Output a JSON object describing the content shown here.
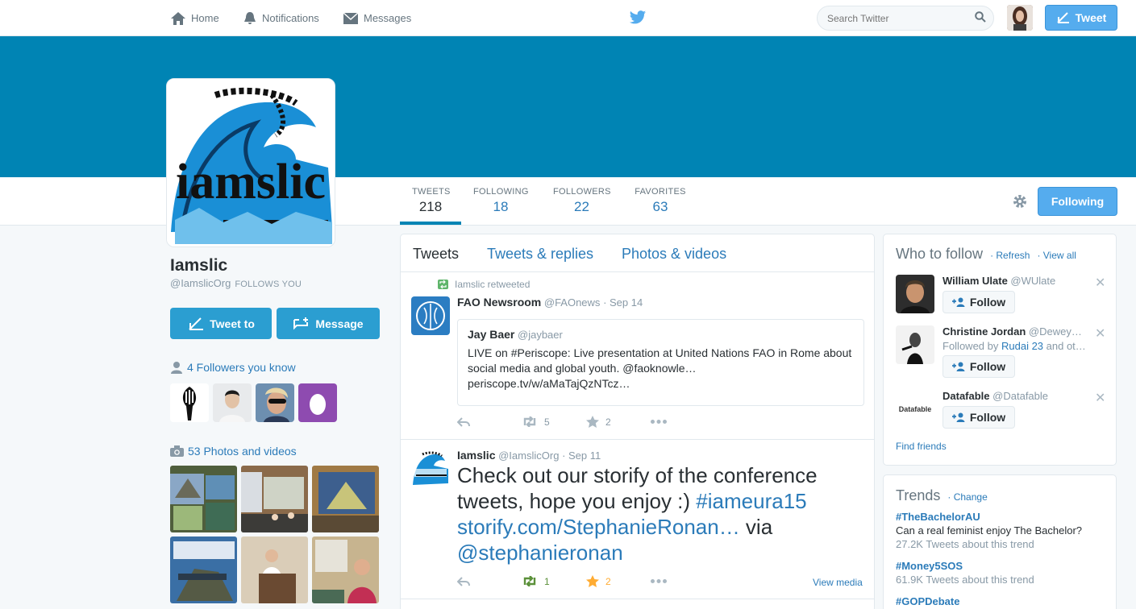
{
  "nav": {
    "home": "Home",
    "notifications": "Notifications",
    "messages": "Messages",
    "search_placeholder": "Search Twitter",
    "tweet_button": "Tweet"
  },
  "colors": {
    "brand": "#0084b4",
    "accent": "#55acee",
    "link": "#2b7bb9"
  },
  "profile": {
    "name": "Iamslic",
    "handle": "@IamslicOrg",
    "follows_you": "FOLLOWS YOU",
    "tweet_to": "Tweet to",
    "message": "Message",
    "followers_you_know": "4 Followers you know",
    "photos_videos": "53 Photos and videos"
  },
  "stats": [
    {
      "label": "TWEETS",
      "value": "218"
    },
    {
      "label": "FOLLOWING",
      "value": "18"
    },
    {
      "label": "FOLLOWERS",
      "value": "22"
    },
    {
      "label": "FAVORITES",
      "value": "63"
    }
  ],
  "following_button": "Following",
  "tabs": [
    "Tweets",
    "Tweets & replies",
    "Photos & videos"
  ],
  "tweets": [
    {
      "retweeted_by": "Iamslic retweeted",
      "name": "FAO Newsroom",
      "handle": "@FAOnews",
      "date": "· Sep 14",
      "quote": {
        "name": "Jay Baer",
        "handle": "@jaybaer",
        "text": "LIVE on #Periscope: Live presentation at United Nations FAO in Rome about social media and global youth. @faoknowle…",
        "link": "periscope.tv/w/aMaTajQzNTcz…"
      },
      "retweets": "5",
      "favorites": "2"
    },
    {
      "name": "Iamslic",
      "handle": "@IamslicOrg",
      "date": "· Sep 11",
      "text_1": "Check out our storify of the conference tweets, hope you enjoy :) ",
      "hashtag": "#iameura15",
      "link": "storify.com/StephanieRonan…",
      "via": " via ",
      "mention": "@stephanieronan",
      "retweets": "1",
      "favorites": "2",
      "view_media": "View media"
    }
  ],
  "who_to_follow": {
    "title": "Who to follow",
    "refresh": "· Refresh",
    "view_all": "· View all",
    "follow_label": "Follow",
    "suggestions": [
      {
        "name": "William Ulate",
        "handle": "@WUlate"
      },
      {
        "name": "Christine Jordan",
        "handle": "@Dewey…",
        "sub_prefix": "Followed by ",
        "sub_link": "Rudai 23",
        "sub_suffix": " and ot…"
      },
      {
        "name": "Datafable",
        "handle": "@Datafable",
        "avatar_text": "Datafable"
      }
    ],
    "find_friends": "Find friends"
  },
  "trends": {
    "title": "Trends",
    "change": "· Change",
    "items": [
      {
        "name": "#TheBachelorAU",
        "desc": "Can a real feminist enjoy The Bachelor?",
        "count": "27.2K Tweets about this trend"
      },
      {
        "name": "#Money5SOS",
        "count": "61.9K Tweets about this trend"
      },
      {
        "name": "#GOPDebate"
      }
    ]
  },
  "avatar_text": "iamslic"
}
